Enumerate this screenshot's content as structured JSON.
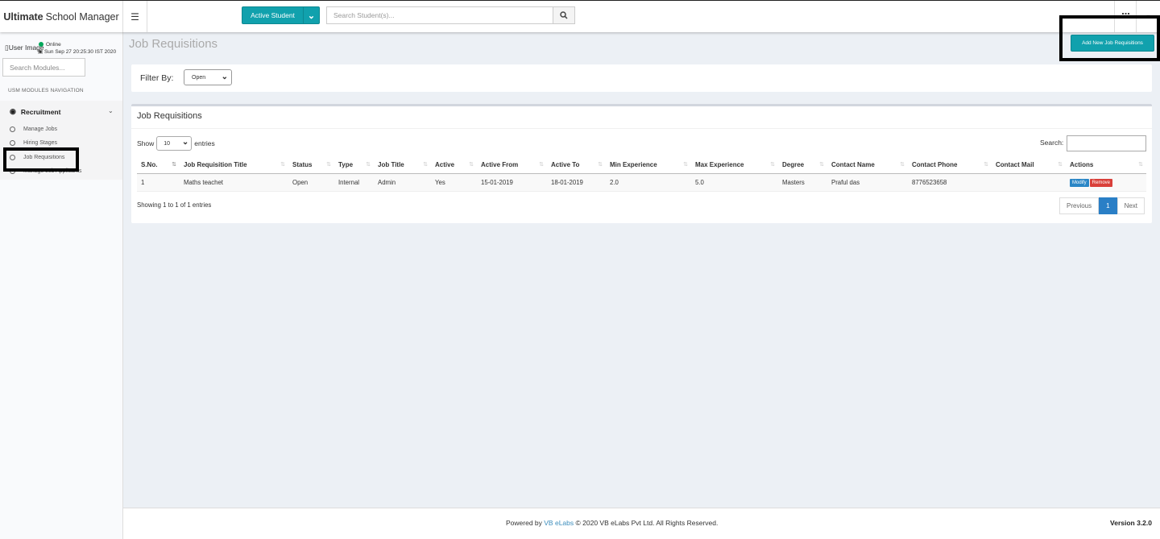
{
  "app": {
    "brand_bold": "Ultimate",
    "brand_rest": "School Manager"
  },
  "header": {
    "menu_icon": "hamburger-icon",
    "active_filter": "Active Student",
    "student_search_placeholder": "Search Student(s)...",
    "search_icon": "search-icon",
    "apps_icon": "grid-icon"
  },
  "sidebar": {
    "user_image_alt": "User Image",
    "status": "Online",
    "datetime": "Sun Sep 27 20:25:30 IST 2020",
    "module_search_placeholder": "Search Modules...",
    "nav_heading": "USM MODULES NAVIGATION",
    "section": "Recruitment",
    "items": [
      {
        "label": "Manage Jobs"
      },
      {
        "label": "Hiring Stages"
      },
      {
        "label": "Job Requisitions"
      },
      {
        "label": "Manage Job Applicants"
      }
    ]
  },
  "main": {
    "page_title": "Job Requisitions",
    "add_button": "Add New Job Requisitions",
    "filter_label": "Filter By:",
    "filter_value": "Open",
    "box_title": "Job Requisitions",
    "show_label": "Show",
    "entries_value": "10",
    "entries_label": "entries",
    "search_label": "Search:",
    "columns": [
      "S.No.",
      "Job Requisition Title",
      "Status",
      "Type",
      "Job Title",
      "Active",
      "Active From",
      "Active To",
      "Min Experience",
      "Max Experience",
      "Degree",
      "Contact Name",
      "Contact Phone",
      "Contact Mail",
      "Actions"
    ],
    "rows": [
      [
        "1",
        "Maths teachet",
        "Open",
        "Internal",
        "Admin",
        "Yes",
        "15-01-2019",
        "18-01-2019",
        "2.0",
        "5.0",
        "Masters",
        "Praful das",
        "8776523658",
        ""
      ]
    ],
    "modify_label": "Modify",
    "remove_label": "Remove",
    "info": "Showing 1 to 1 of 1 entries",
    "prev": "Previous",
    "page": "1",
    "next": "Next"
  },
  "footer": {
    "powered_by": "Powered by",
    "company": "VB eLabs",
    "copyright": "© 2020 VB eLabs Pvt Ltd. All Rights Reserved.",
    "version": "Version 3.2.0"
  },
  "colors": {
    "accent": "#11a1ad",
    "primary": "#2a86c6",
    "danger": "#d9403a",
    "highlight": "#000000"
  }
}
